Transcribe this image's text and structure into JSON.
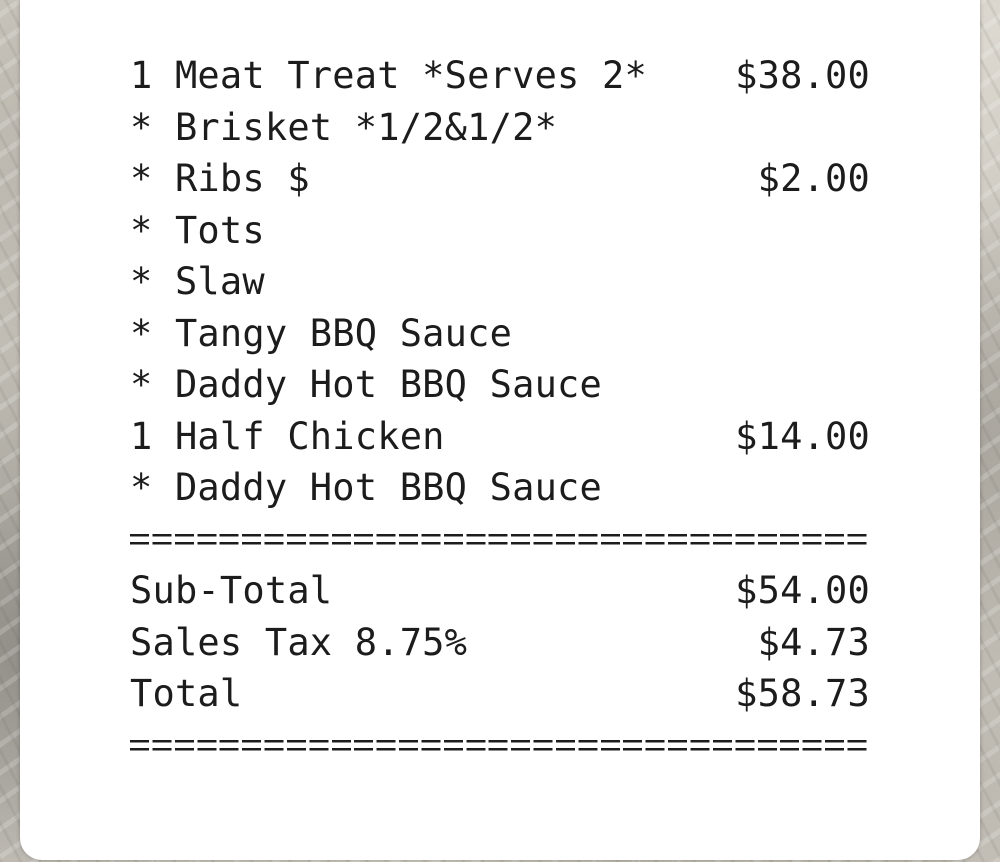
{
  "receipt": {
    "items": [
      {
        "label": "1 Meat Treat *Serves 2*",
        "amount": "$38.00"
      },
      {
        "label": "* Brisket *1/2&1/2*",
        "amount": ""
      },
      {
        "label": "* Ribs $",
        "amount": "$2.00"
      },
      {
        "label": "* Tots",
        "amount": ""
      },
      {
        "label": "* Slaw",
        "amount": ""
      },
      {
        "label": "* Tangy BBQ Sauce",
        "amount": ""
      },
      {
        "label": "* Daddy Hot BBQ Sauce",
        "amount": ""
      },
      {
        "label": "1 Half Chicken",
        "amount": "$14.00"
      },
      {
        "label": "* Daddy Hot BBQ Sauce",
        "amount": ""
      }
    ],
    "totals": [
      {
        "label": "Sub-Total",
        "amount": "$54.00"
      },
      {
        "label": "Sales Tax 8.75%",
        "amount": "$4.73"
      },
      {
        "label": "Total",
        "amount": "$58.73"
      }
    ]
  }
}
